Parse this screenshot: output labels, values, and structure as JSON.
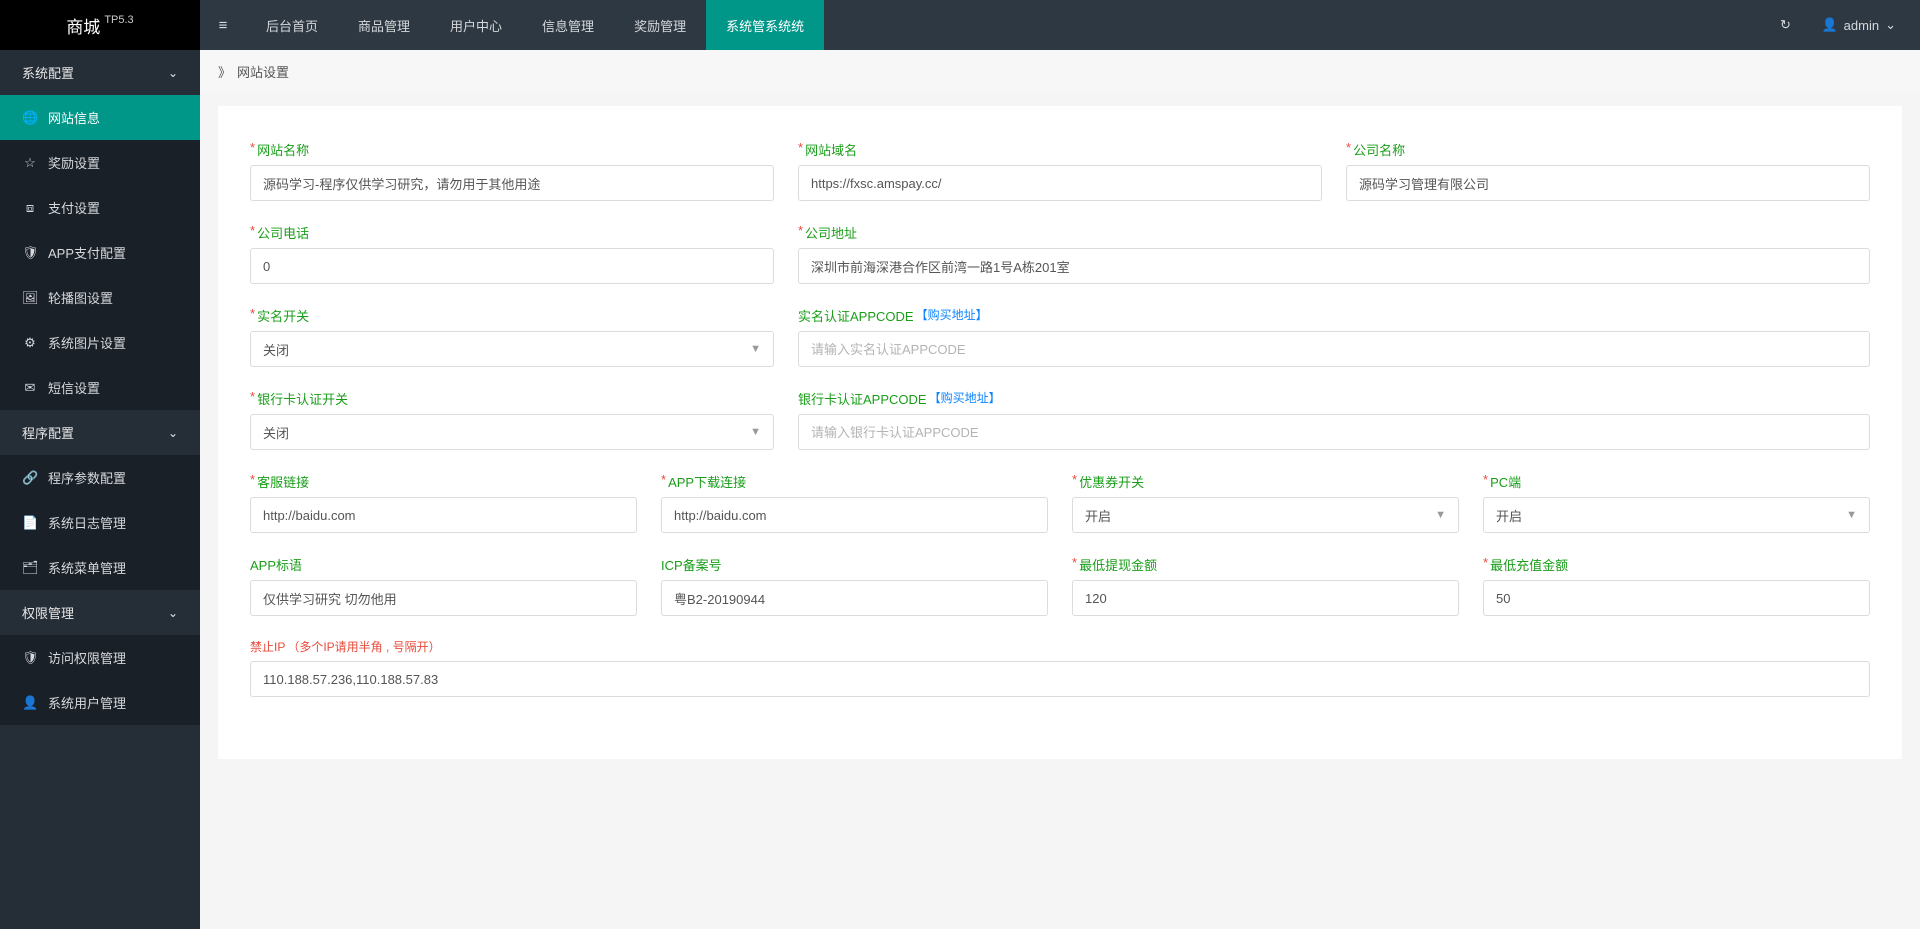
{
  "brand": {
    "name": "商城",
    "badge": "TP5.3"
  },
  "topmenu": {
    "items": [
      {
        "label": "后台首页"
      },
      {
        "label": "商品管理"
      },
      {
        "label": "用户中心"
      },
      {
        "label": "信息管理"
      },
      {
        "label": "奖励管理"
      },
      {
        "label": "系统管系统统"
      }
    ],
    "activeIndex": 5
  },
  "user": {
    "name": "admin"
  },
  "sidebar": {
    "groups": [
      {
        "label": "系统配置",
        "open": true,
        "items": [
          {
            "icon": "🌐",
            "label": "网站信息",
            "active": true
          },
          {
            "icon": "☆",
            "label": "奖励设置"
          },
          {
            "icon": "⧈",
            "label": "支付设置"
          },
          {
            "icon": "🛡",
            "label": "APP支付配置"
          },
          {
            "icon": "🖼",
            "label": "轮播图设置"
          },
          {
            "icon": "⚙",
            "label": "系统图片设置"
          },
          {
            "icon": "✉",
            "label": "短信设置"
          }
        ]
      },
      {
        "label": "程序配置",
        "open": true,
        "items": [
          {
            "icon": "🔗",
            "label": "程序参数配置"
          },
          {
            "icon": "📄",
            "label": "系统日志管理"
          },
          {
            "icon": "🗂",
            "label": "系统菜单管理"
          }
        ]
      },
      {
        "label": "权限管理",
        "open": true,
        "items": [
          {
            "icon": "🛡",
            "label": "访问权限管理"
          },
          {
            "icon": "👤",
            "label": "系统用户管理"
          }
        ]
      }
    ]
  },
  "breadcrumb": {
    "title": "网站设置"
  },
  "form": {
    "site_name": {
      "label": "网站名称",
      "value": "源码学习-程序仅供学习研究，请勿用于其他用途",
      "required": true
    },
    "site_domain": {
      "label": "网站域名",
      "value": "https://fxsc.amspay.cc/",
      "required": true
    },
    "company_name": {
      "label": "公司名称",
      "value": "源码学习管理有限公司",
      "required": true
    },
    "company_phone": {
      "label": "公司电话",
      "value": "0",
      "required": true
    },
    "company_address": {
      "label": "公司地址",
      "value": "深圳市前海深港合作区前湾一路1号A栋201室",
      "required": true
    },
    "realname_switch": {
      "label": "实名开关",
      "value": "关闭",
      "required": true
    },
    "realname_appcode": {
      "label": "实名认证APPCODE",
      "link_text": "【购买地址】",
      "value": "",
      "placeholder": "请输入实名认证APPCODE"
    },
    "bankcard_switch": {
      "label": "银行卡认证开关",
      "value": "关闭",
      "required": true
    },
    "bankcard_appcode": {
      "label": "银行卡认证APPCODE",
      "link_text": "【购买地址】",
      "value": "",
      "placeholder": "请输入银行卡认证APPCODE"
    },
    "cs_link": {
      "label": "客服链接",
      "value": "http://baidu.com",
      "required": true
    },
    "app_download": {
      "label": "APP下载连接",
      "value": "http://baidu.com",
      "required": true
    },
    "coupon_switch": {
      "label": "优惠券开关",
      "value": "开启",
      "required": true
    },
    "pc_switch": {
      "label": "PC端",
      "value": "开启",
      "required": true
    },
    "app_slogan": {
      "label": "APP标语",
      "value": "仅供学习研究 切勿他用"
    },
    "icp": {
      "label": "ICP备案号",
      "value": "粤B2-20190944"
    },
    "min_withdraw": {
      "label": "最低提现金额",
      "value": "120",
      "required": true
    },
    "min_recharge": {
      "label": "最低充值金额",
      "value": "50",
      "required": true
    },
    "block_ip": {
      "label": "禁止IP",
      "note": "（多个IP请用半角 , 号隔开）",
      "value": "110.188.57.236,110.188.57.83"
    }
  }
}
